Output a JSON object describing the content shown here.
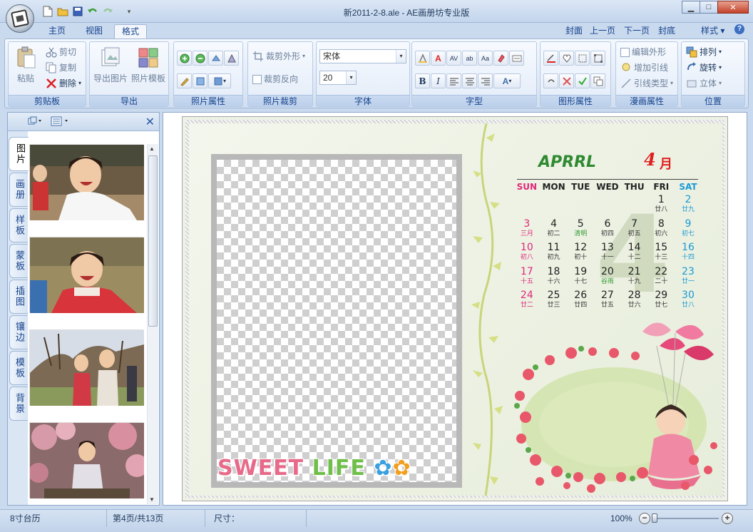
{
  "window": {
    "title": "新2011-2-8.ale - AE画册坊专业版",
    "controls": {
      "minimize": "▁",
      "maximize": "□",
      "close": "✕"
    }
  },
  "quick_access": {
    "icons": [
      "new-file-icon",
      "open-folder-icon",
      "save-icon",
      "undo-icon",
      "redo-icon",
      "customize-icon"
    ]
  },
  "tabs": [
    {
      "label": "主页",
      "active": false
    },
    {
      "label": "视图",
      "active": false
    },
    {
      "label": "格式",
      "active": true
    }
  ],
  "page_nav": {
    "cover": "封面",
    "prev": "上一页",
    "next": "下一页",
    "back_cover": "封底",
    "style": "样式",
    "style_arrow": "▾",
    "help": "?"
  },
  "ribbon": {
    "clipboard": {
      "label": "剪贴板",
      "paste": "粘贴",
      "cut": "剪切",
      "copy": "复制",
      "delete": "删除"
    },
    "export": {
      "label": "导出",
      "export_image": "导出图片",
      "photo_template": "照片模板"
    },
    "photo_props": {
      "label": "照片属性"
    },
    "photo_crop": {
      "label": "照片裁剪",
      "crop_shape": "裁剪外形",
      "crop_reverse": "裁剪反向"
    },
    "font": {
      "label": "字体",
      "family": "宋体",
      "size": "20"
    },
    "text_style": {
      "label": "字型"
    },
    "shape_props": {
      "label": "图形属性"
    },
    "comic_props": {
      "label": "漫画属性",
      "edit_shape": "编辑外形",
      "add_leader": "增加引线",
      "leader_type": "引线类型"
    },
    "position": {
      "label": "位置",
      "arrange": "排列",
      "rotate": "旋转",
      "stereo": "立体"
    }
  },
  "left_panel": {
    "vertical_tabs": [
      {
        "label": "图片",
        "active": true
      },
      {
        "label": "画册",
        "active": false
      },
      {
        "label": "样板",
        "active": false
      },
      {
        "label": "蒙板",
        "active": false
      },
      {
        "label": "插图",
        "active": false
      },
      {
        "label": "镶边",
        "active": false
      },
      {
        "label": "模板",
        "active": false
      },
      {
        "label": "背景",
        "active": false
      }
    ],
    "close": "✕"
  },
  "calendar": {
    "month_en": "APRRL",
    "month_num": "4",
    "month_ch": "月",
    "watermark": "4",
    "weekdays": [
      "SUN",
      "MON",
      "TUE",
      "WED",
      "THU",
      "FRI",
      "SAT"
    ],
    "weeks": [
      [
        null,
        null,
        null,
        null,
        null,
        {
          "d": "1",
          "l": "廿八"
        },
        {
          "d": "2",
          "l": "廿九"
        }
      ],
      [
        {
          "d": "3",
          "l": "三月"
        },
        {
          "d": "4",
          "l": "初二"
        },
        {
          "d": "5",
          "l": "清明",
          "fest": true
        },
        {
          "d": "6",
          "l": "初四"
        },
        {
          "d": "7",
          "l": "初五"
        },
        {
          "d": "8",
          "l": "初六"
        },
        {
          "d": "9",
          "l": "初七"
        }
      ],
      [
        {
          "d": "10",
          "l": "初八"
        },
        {
          "d": "11",
          "l": "初九"
        },
        {
          "d": "12",
          "l": "初十"
        },
        {
          "d": "13",
          "l": "十一"
        },
        {
          "d": "14",
          "l": "十二"
        },
        {
          "d": "15",
          "l": "十三"
        },
        {
          "d": "16",
          "l": "十四"
        }
      ],
      [
        {
          "d": "17",
          "l": "十五"
        },
        {
          "d": "18",
          "l": "十六"
        },
        {
          "d": "19",
          "l": "十七"
        },
        {
          "d": "20",
          "l": "谷雨",
          "fest": true
        },
        {
          "d": "21",
          "l": "十九"
        },
        {
          "d": "22",
          "l": "二十"
        },
        {
          "d": "23",
          "l": "廿一"
        }
      ],
      [
        {
          "d": "24",
          "l": "廿二"
        },
        {
          "d": "25",
          "l": "廿三"
        },
        {
          "d": "26",
          "l": "廿四"
        },
        {
          "d": "27",
          "l": "廿五"
        },
        {
          "d": "28",
          "l": "廿六"
        },
        {
          "d": "29",
          "l": "廿七"
        },
        {
          "d": "30",
          "l": "廿八"
        }
      ]
    ]
  },
  "decoration": {
    "sweet_life": [
      "SWEET",
      "LIFE"
    ]
  },
  "status": {
    "format": "8寸台历",
    "page": "第4页/共13页",
    "size_label": "尺寸：",
    "zoom": "100%",
    "zoom_minus": "−",
    "zoom_plus": "+"
  },
  "colors": {
    "accent": "#15428b",
    "sunday": "#e0287a",
    "saturday": "#1a9ad6",
    "festival": "#2e9a30",
    "month_title": "#2e8a30"
  }
}
